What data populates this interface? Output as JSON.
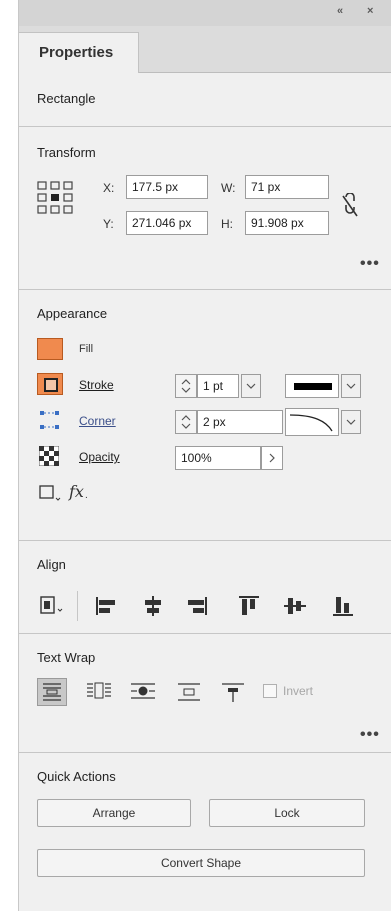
{
  "header": {
    "collapse_label": "«",
    "close_label": "×"
  },
  "tabs": [
    {
      "label": "Properties"
    }
  ],
  "object_type": "Rectangle",
  "transform": {
    "heading": "Transform",
    "x_label": "X:",
    "x_value": "177.5 px",
    "y_label": "Y:",
    "y_value": "271.046 px",
    "w_label": "W:",
    "w_value": "71 px",
    "h_label": "H:",
    "h_value": "91.908 px",
    "more": "•••"
  },
  "appearance": {
    "heading": "Appearance",
    "fill_label": "Fill",
    "fill_color": "#f08a4e",
    "stroke_label": "Stroke",
    "stroke_weight": "1 pt",
    "corner_label": "Corner",
    "corner_size": "2 px",
    "opacity_label": "Opacity",
    "opacity_value": "100%",
    "fx_label": "fx"
  },
  "align": {
    "heading": "Align"
  },
  "text_wrap": {
    "heading": "Text Wrap",
    "invert_label": "Invert",
    "more": "•••"
  },
  "quick_actions": {
    "heading": "Quick Actions",
    "arrange_label": "Arrange",
    "lock_label": "Lock",
    "convert_shape_label": "Convert Shape"
  }
}
